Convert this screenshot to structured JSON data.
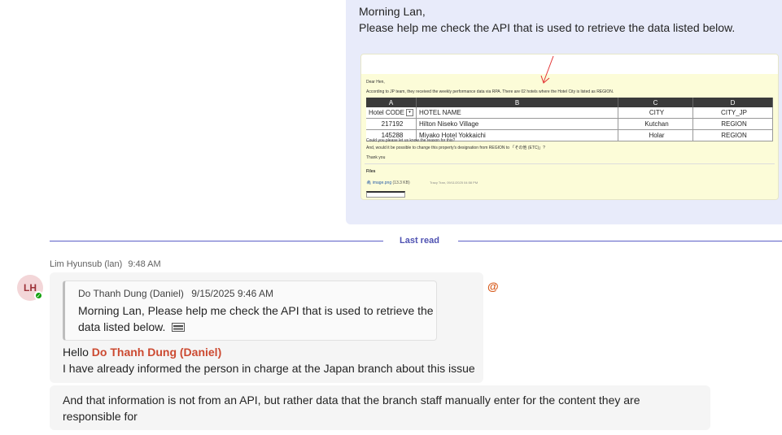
{
  "sent_message": {
    "line1": "Morning Lan,",
    "line2": "Please help me check the API that is used to retrieve the data listed below."
  },
  "attachment_preview": {
    "greeting": "Dear Hen,",
    "intro": "According to JP team, they received the weekly performance data via RPA. There are 02 hotels where the Hotel City is listed as REGION.",
    "columns": [
      "A",
      "B",
      "C",
      "D"
    ],
    "headers": [
      "Hotel CODE",
      "HOTEL NAME",
      "CITY",
      "CITY_JP"
    ],
    "rows": [
      [
        "217192",
        "Hilton Niseko Village",
        "Kutchan",
        "REGION"
      ],
      [
        "145288",
        "Miyako Hotel Yokkaichi",
        "Holar",
        "REGION"
      ]
    ],
    "question1": "Could you please let us know the reason for this?",
    "question2": "And, would it be possible to change this property's designation from REGION to 「その他 (ETC)」?",
    "thanks": "Thank you",
    "files_label": "Files",
    "file_name": "image.png",
    "file_size": "(13.3 KB)",
    "file_meta": "Tracy Tran, 09/11/2025 04:58 PM"
  },
  "last_read_label": "Last read",
  "sender": {
    "name": "Lim Hyunsub (lan)",
    "time": "9:48 AM",
    "initials": "LH"
  },
  "quote": {
    "author": "Do Thanh Dung (Daniel)",
    "time": "9/15/2025 9:46 AM",
    "text": "Morning Lan, Please help me check the API that is used to retrieve the data listed below."
  },
  "reply": {
    "hello": "Hello",
    "mention": "Do Thanh Dung (Daniel)",
    "line2": "I have already informed the person in charge at the Japan branch about this issue"
  },
  "mention_indicator": "@",
  "followup": {
    "text": "And that information is not from an API, but rather data that the branch staff manually enter for the content they are responsible for"
  },
  "colors": {
    "sent_bubble": "#e8ebfa",
    "received_bubble": "#f5f5f5",
    "accent": "#5b5fc7",
    "mention": "#cc4a31",
    "presence": "#13a10e"
  }
}
